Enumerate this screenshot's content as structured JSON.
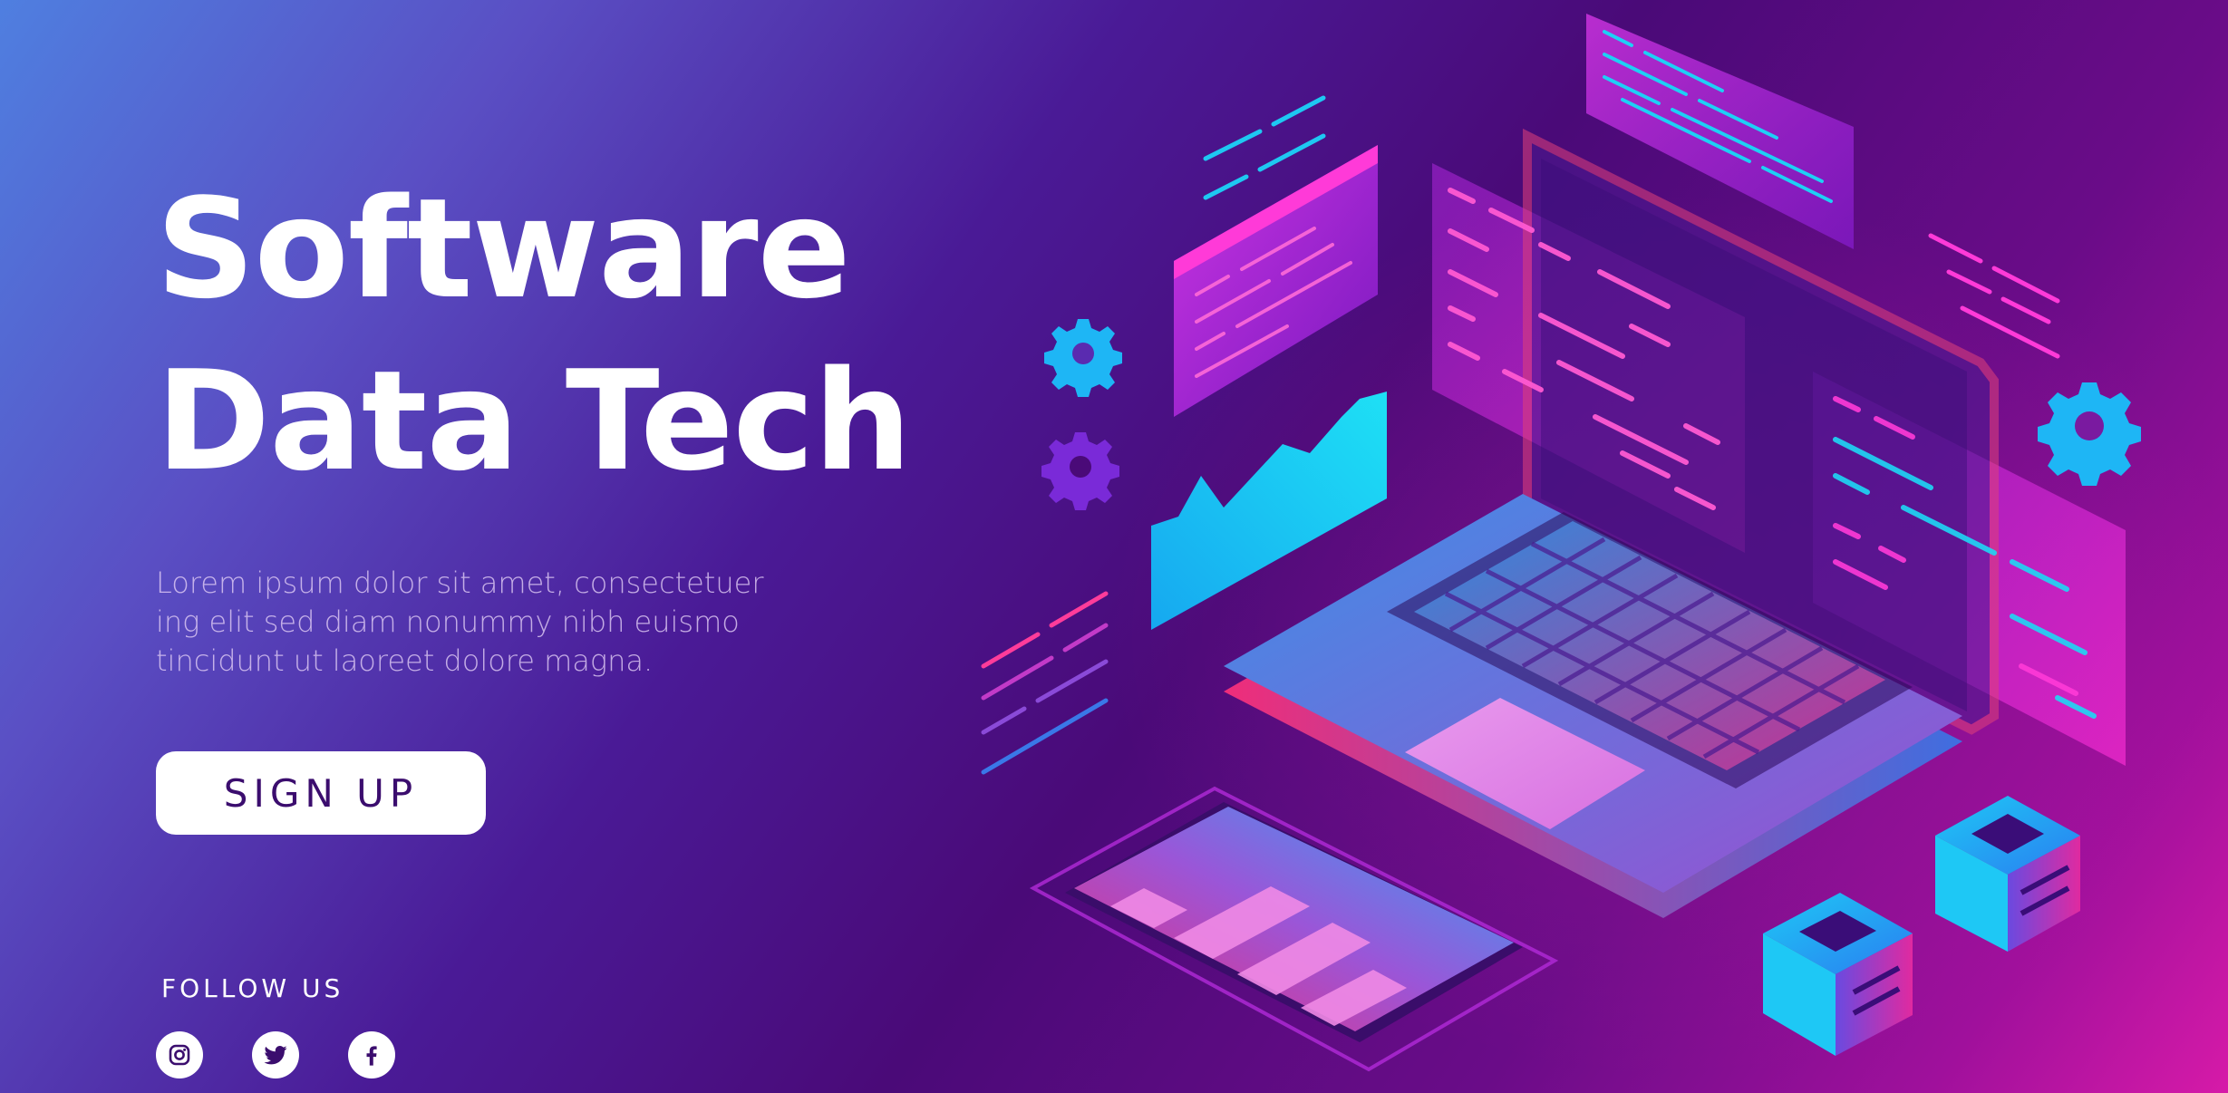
{
  "hero": {
    "title": "Software\nData Tech",
    "description": "Lorem ipsum dolor sit amet, consectetuer\ning elit sed diam nonummy nibh euismo\ntincidunt ut laoreet dolore magna.",
    "cta_label": "SIGN UP"
  },
  "social": {
    "heading": "FOLLOW US",
    "links": [
      {
        "name": "instagram",
        "icon": "instagram-icon"
      },
      {
        "name": "twitter",
        "icon": "twitter-icon"
      },
      {
        "name": "facebook",
        "icon": "facebook-icon"
      }
    ]
  },
  "colors": {
    "background_start": "#4f7fe0",
    "background_mid": "#4a0a78",
    "background_end": "#d61aa8",
    "cyan_accent": "#1ecbf2",
    "magenta_accent": "#ff2fd6",
    "button_text": "#3b0d6e"
  }
}
